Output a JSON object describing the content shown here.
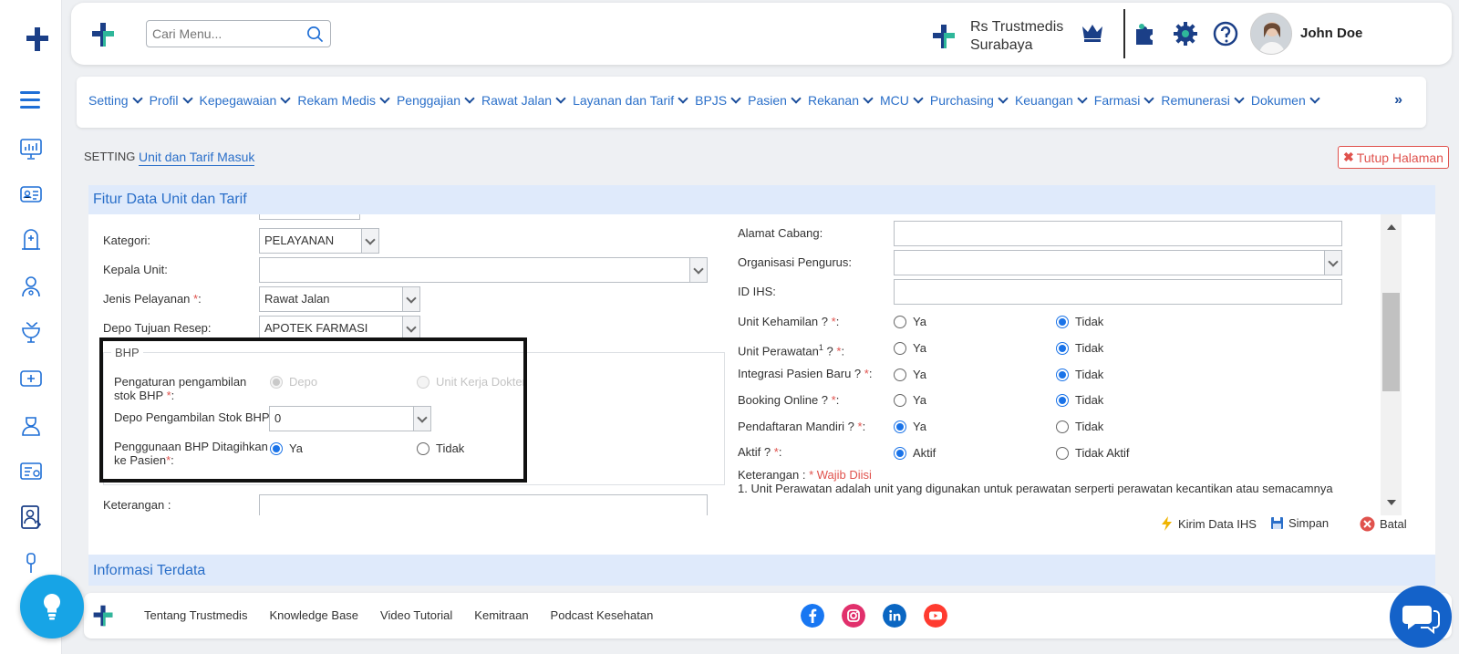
{
  "header": {
    "search_placeholder": "Cari Menu...",
    "hospital_name": "Rs Trustmedis Surabaya",
    "user_name": "John Doe"
  },
  "nav": {
    "items": [
      "Setting",
      "Profil",
      "Kepegawaian",
      "Rekam Medis",
      "Penggajian",
      "Rawat Jalan",
      "Layanan dan Tarif",
      "BPJS",
      "Pasien",
      "Rekanan",
      "MCU",
      "Purchasing",
      "Keuangan",
      "Farmasi",
      "Remunerasi",
      "Dokumen"
    ],
    "more": "»"
  },
  "breadcrumb": {
    "root": "SETTING",
    "current": "Unit dan Tarif Masuk"
  },
  "close_page": "Tutup Halaman",
  "panel_title": "Fitur Data Unit dan Tarif",
  "left_form": {
    "kategori_label": "Kategori:",
    "kategori_value": "PELAYANAN",
    "kepala_label": "Kepala Unit:",
    "kepala_value": "",
    "jenis_label": "Jenis Pelayanan ",
    "jenis_value": "Rawat Jalan",
    "depo_label": "Depo Tujuan Resep:",
    "depo_value": "APOTEK FARMASI",
    "bhp_legend": "BHP",
    "pengaturan_label": "Pengaturan pengambilan stok BHP ",
    "pengaturan_opt1": "Depo",
    "pengaturan_opt2": "Unit Kerja Dokter",
    "depo_bhp_label": "Depo Pengambilan Stok BHP:",
    "depo_bhp_value": "0",
    "penggunaan_label": "Penggunaan BHP Ditagihkan ke Pasien",
    "penggunaan_opt1": "Ya",
    "penggunaan_opt2": "Tidak",
    "keterangan_label": "Keterangan :"
  },
  "right_form": {
    "alamat_label": "Alamat Cabang:",
    "organisasi_label": "Organisasi Pengurus:",
    "idihs_label": "ID IHS:",
    "kehamilan_label": "Unit Kehamilan ? ",
    "perawatan_label": "Unit Perawatan",
    "perawatan_sup": "1",
    "perawatan_suffix": " ? ",
    "integrasi_label": "Integrasi Pasien Baru ? ",
    "booking_label": "Booking Online ? ",
    "mandiri_label": "Pendaftaran Mandiri ? ",
    "aktif_label": "Aktif ? ",
    "opt_ya": "Ya",
    "opt_tidak": "Tidak",
    "opt_aktif": "Aktif",
    "opt_tidak_aktif": "Tidak Aktif",
    "req_mark": "*",
    "colon": ":",
    "keterangan_title": "Keterangan : ",
    "wajib": "* Wajib Diisi",
    "note_1": "1. Unit Perawatan adalah unit yang digunakan untuk perawatan serperti perawatan kecantikan atau semacamnya"
  },
  "actions": {
    "kirim": "Kirim Data IHS",
    "simpan": "Simpan",
    "batal": "Batal"
  },
  "panel2_title": "Informasi Terdata",
  "footer": {
    "links": [
      "Tentang Trustmedis",
      "Knowledge Base",
      "Video Tutorial",
      "Kemitraan",
      "Podcast Kesehatan"
    ]
  },
  "colors": {
    "primary": "#2a6fc9",
    "danger": "#e0524d",
    "logo_teal": "#2fb79a",
    "logo_navy": "#1b3f87"
  }
}
